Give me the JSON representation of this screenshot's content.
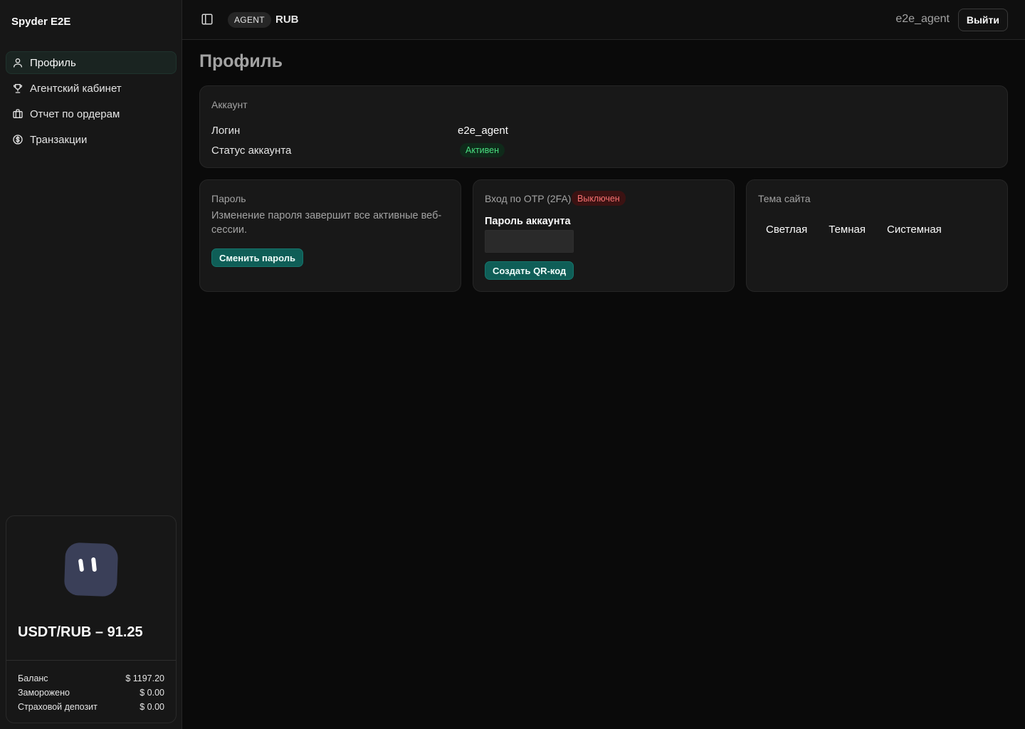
{
  "sidebar": {
    "brand": "Spyder E2E",
    "items": [
      {
        "label": "Профиль",
        "icon": "user-icon",
        "active": true
      },
      {
        "label": "Агентский кабинет",
        "icon": "trophy-icon"
      },
      {
        "label": "Отчет по ордерам",
        "icon": "briefcase-icon"
      },
      {
        "label": "Транзакции",
        "icon": "dollar-circle-icon"
      }
    ],
    "rate": {
      "text": "USDT/RUB – 91.25",
      "rows": [
        {
          "label": "Баланс",
          "value": "$ 1197.20"
        },
        {
          "label": "Заморожено",
          "value": "$ 0.00"
        },
        {
          "label": "Страховой депозит",
          "value": "$ 0.00"
        }
      ]
    }
  },
  "header": {
    "role": "AGENT",
    "currency": "RUB",
    "username": "e2e_agent",
    "logout_label": "Выйти"
  },
  "page": {
    "title": "Профиль",
    "account": {
      "title": "Аккаунт",
      "login_label": "Логин",
      "login_value": "e2e_agent",
      "status_label": "Статус аккаунта",
      "status_value": "Активен"
    },
    "password": {
      "title": "Пароль",
      "description": "Изменение пароля завершит все активные веб-сессии.",
      "button": "Сменить пароль"
    },
    "otp": {
      "title": "Вход по OTP (2FA)",
      "status": "Выключен",
      "field_label": "Пароль аккаунта",
      "field_value": "",
      "button": "Создать QR-код"
    },
    "theme": {
      "title": "Тема сайта",
      "options": [
        "Светлая",
        "Темная",
        "Системная"
      ]
    }
  },
  "colors": {
    "accent": "#0f5e57",
    "active_badge": "#4ade80",
    "disabled_badge": "#f87171",
    "background": "#0a0a0a",
    "card": "#181818"
  }
}
